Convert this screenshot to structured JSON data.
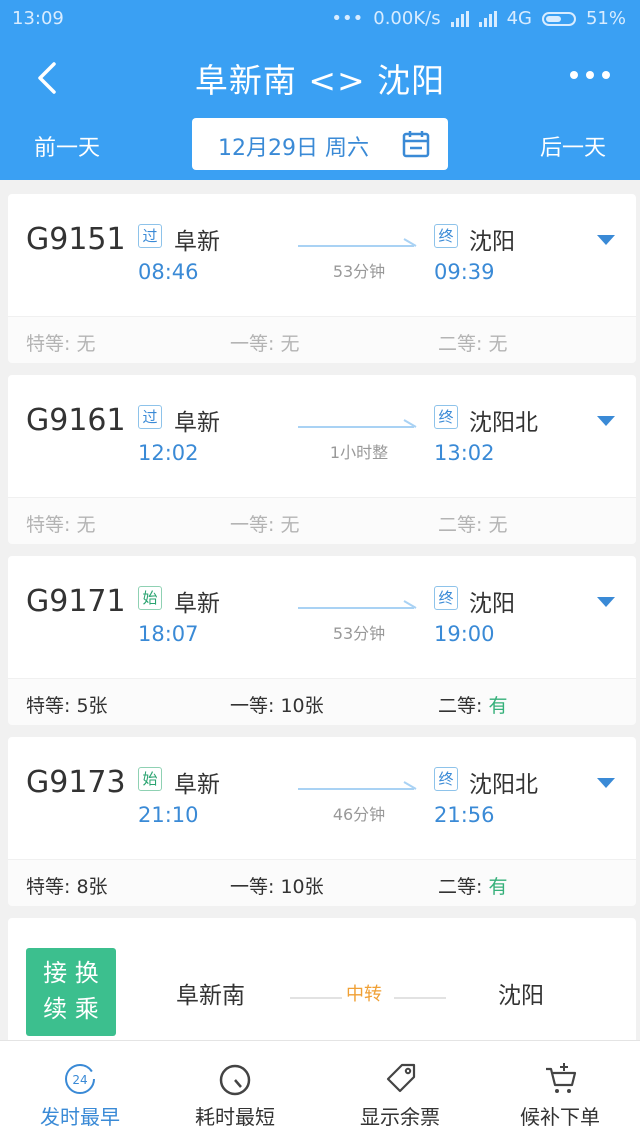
{
  "status_bar": {
    "time": "13:09",
    "dots": "•••",
    "speed": "0.00K/s",
    "network": "4G",
    "battery": "51%"
  },
  "header": {
    "title": "阜新南 <> 沈阳",
    "prev_day": "前一天",
    "next_day": "后一天",
    "date": "12月29日 周六"
  },
  "trains": [
    {
      "number": "G9151",
      "from_tag": "过",
      "from_station": "阜新",
      "depart": "08:46",
      "duration": "53分钟",
      "to_tag": "终",
      "to_station": "沈阳",
      "arrive": "09:39",
      "seats": [
        {
          "label": "特等: ",
          "value": "无"
        },
        {
          "label": "一等: ",
          "value": "无"
        },
        {
          "label": "二等: ",
          "value": "无"
        }
      ]
    },
    {
      "number": "G9161",
      "from_tag": "过",
      "from_station": "阜新",
      "depart": "12:02",
      "duration": "1小时整",
      "to_tag": "终",
      "to_station": "沈阳北",
      "arrive": "13:02",
      "seats": [
        {
          "label": "特等: ",
          "value": "无"
        },
        {
          "label": "一等: ",
          "value": "无"
        },
        {
          "label": "二等: ",
          "value": "无"
        }
      ]
    },
    {
      "number": "G9171",
      "from_tag": "始",
      "from_station": "阜新",
      "depart": "18:07",
      "duration": "53分钟",
      "to_tag": "终",
      "to_station": "沈阳",
      "arrive": "19:00",
      "seats": [
        {
          "label": "特等: ",
          "value": "5张"
        },
        {
          "label": "一等: ",
          "value": "10张"
        },
        {
          "label": "二等: ",
          "value": "有"
        }
      ]
    },
    {
      "number": "G9173",
      "from_tag": "始",
      "from_station": "阜新",
      "depart": "21:10",
      "duration": "46分钟",
      "to_tag": "终",
      "to_station": "沈阳北",
      "arrive": "21:56",
      "seats": [
        {
          "label": "特等: ",
          "value": "8张"
        },
        {
          "label": "一等: ",
          "value": "10张"
        },
        {
          "label": "二等: ",
          "value": "有"
        }
      ]
    }
  ],
  "transfer": {
    "badge_line1": "接 换",
    "badge_line2": "续 乘",
    "from": "阜新南",
    "via": "中转",
    "to": "沈阳"
  },
  "tabs": [
    {
      "label": "发时最早",
      "icon": "clock-24-icon"
    },
    {
      "label": "耗时最短",
      "icon": "stopwatch-icon"
    },
    {
      "label": "显示余票",
      "icon": "ticket-tag-icon"
    },
    {
      "label": "候补下单",
      "icon": "cart-plus-icon"
    }
  ],
  "tab_icon_text": "24",
  "colors": {
    "primary": "#3aa0f3",
    "accent_blue": "#3a8ad6",
    "available_green": "#35b07a",
    "transfer_orange": "#f0a035"
  }
}
